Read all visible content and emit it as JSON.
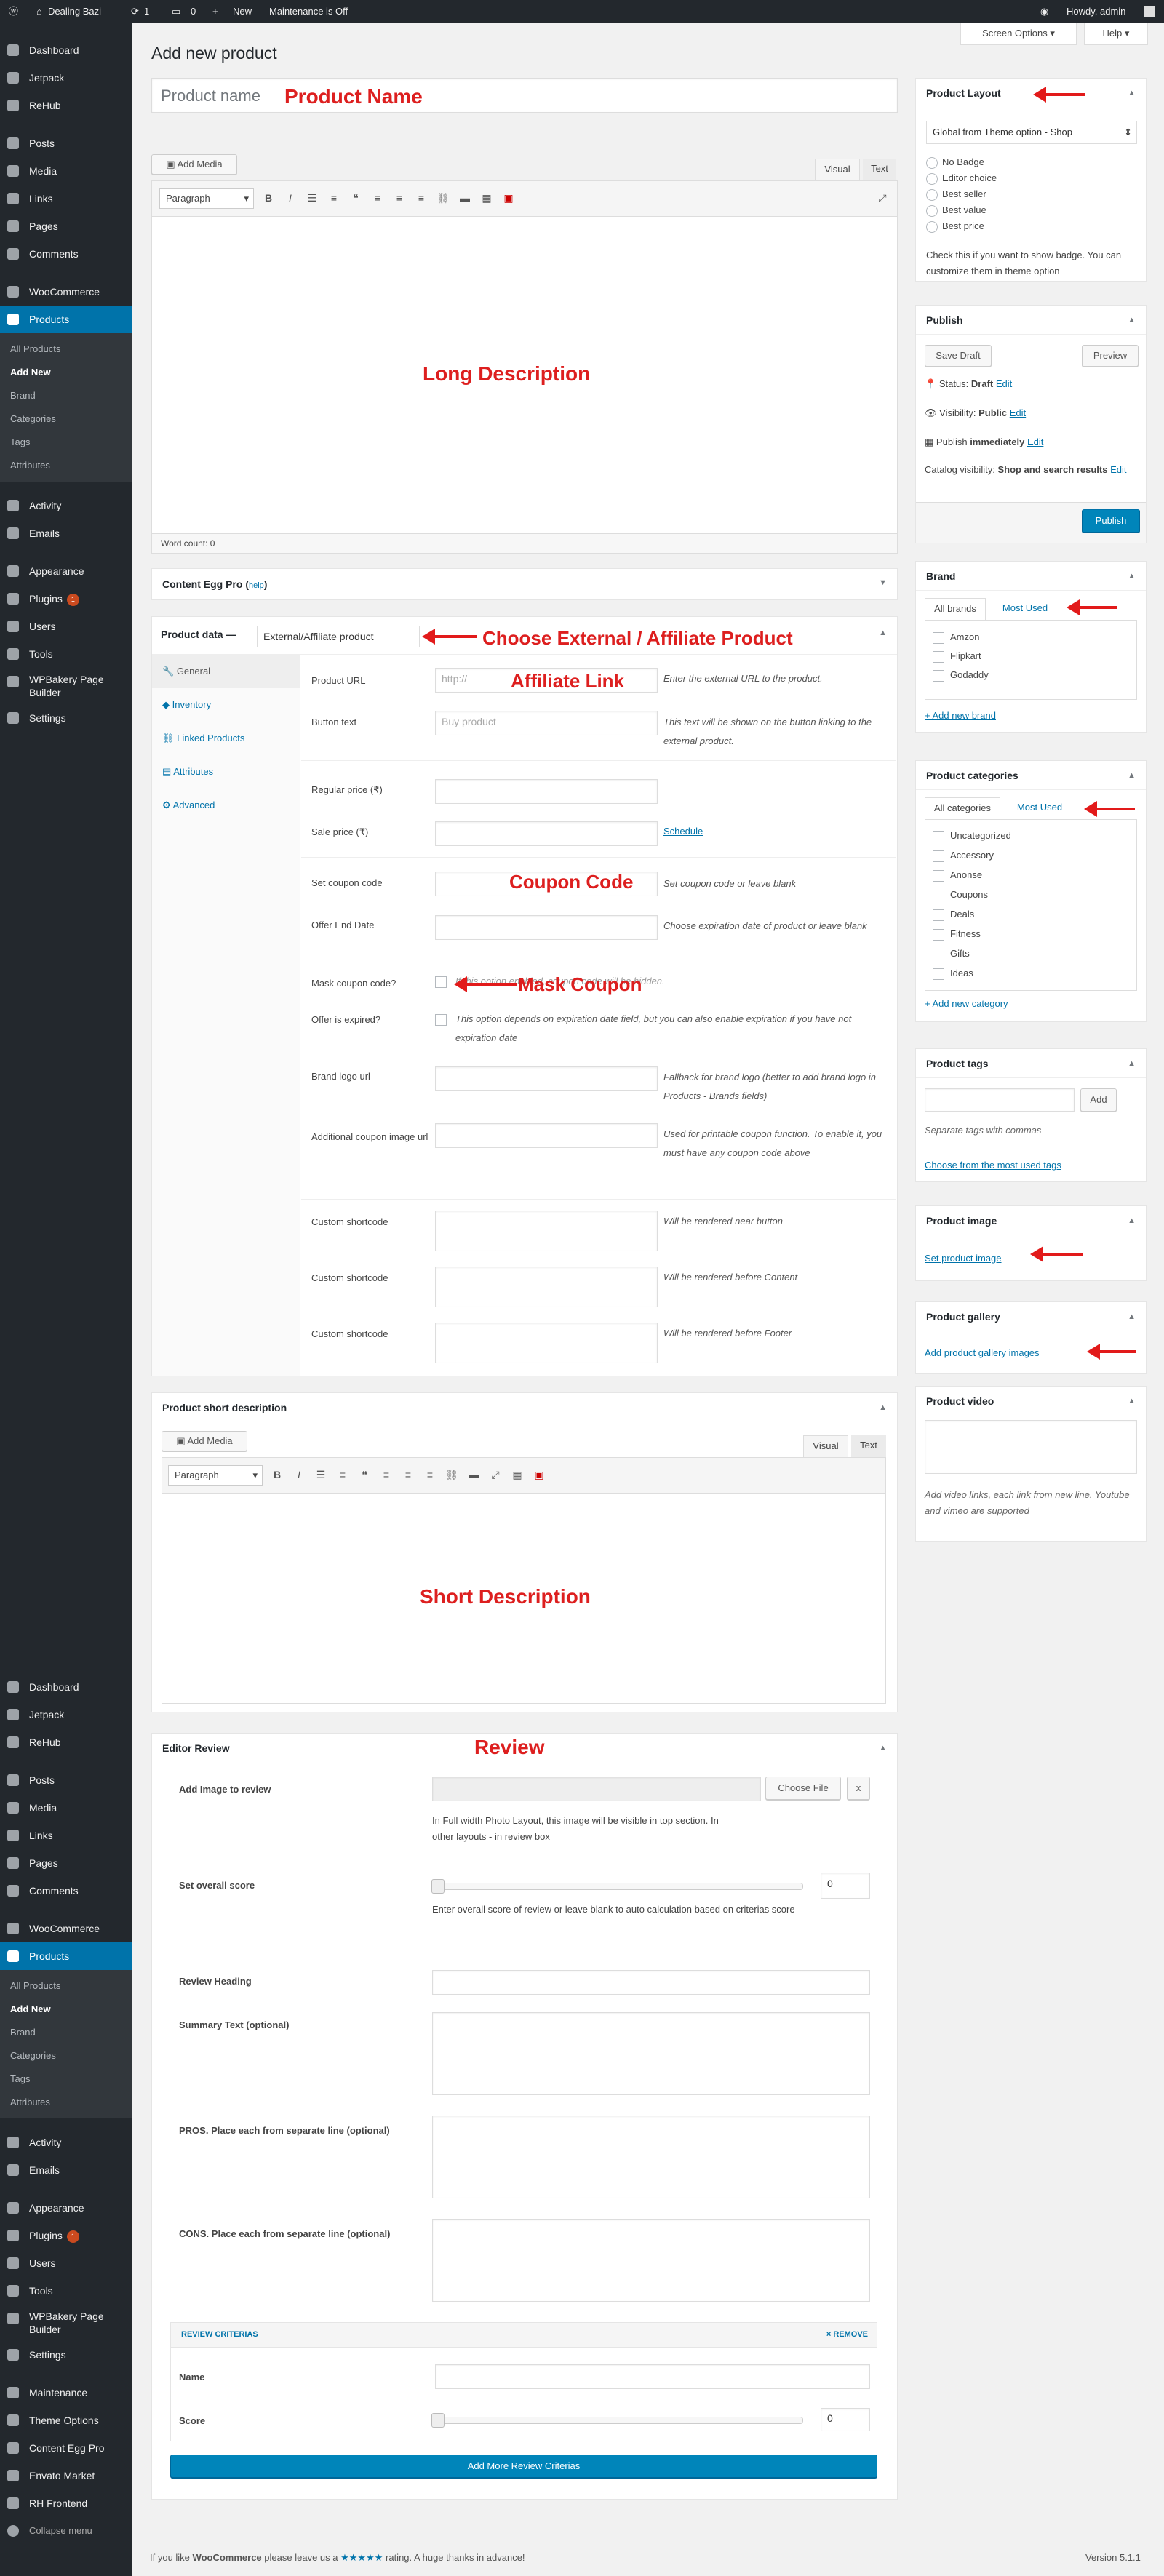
{
  "adminbar": {
    "site": "Dealing Bazi",
    "updates": "1",
    "comments": "0",
    "new": "New",
    "maintenance": "Maintenance is Off",
    "howdy": "Howdy, admin"
  },
  "sidebar": {
    "group1": [
      "Dashboard",
      "Jetpack",
      "ReHub"
    ],
    "group2": [
      "Posts",
      "Media",
      "Links",
      "Pages",
      "Comments"
    ],
    "woocommerce": "WooCommerce",
    "products": "Products",
    "product_sub": [
      "All Products",
      "Add New",
      "Brand",
      "Categories",
      "Tags",
      "Attributes"
    ],
    "group3": [
      "Activity",
      "Emails"
    ],
    "group4": [
      "Appearance",
      "Plugins",
      "Users",
      "Tools",
      "WPBakery Page Builder",
      "Settings"
    ],
    "plugins_badge": "1",
    "group5": [
      "Maintenance",
      "Theme Options",
      "Content Egg Pro",
      "Envato Market",
      "RH Frontend"
    ],
    "collapse": "Collapse menu"
  },
  "header": {
    "title": "Add new product",
    "screen_options": "Screen Options",
    "help": "Help"
  },
  "title_field": {
    "placeholder": "Product name",
    "annotation": "Product Name"
  },
  "editor": {
    "add_media": "Add Media",
    "visual": "Visual",
    "text": "Text",
    "paragraph": "Paragraph",
    "annotation": "Long Description",
    "word_count": "Word count: 0"
  },
  "content_egg": {
    "label": "Content Egg Pro",
    "help": "help"
  },
  "product_data": {
    "label": "Product data —",
    "type": "External/Affiliate product",
    "annotation": "Choose External / Affiliate Product",
    "tabs": [
      "General",
      "Inventory",
      "Linked Products",
      "Attributes",
      "Advanced"
    ],
    "product_url": {
      "label": "Product URL",
      "placeholder": "http://",
      "annotation": "Affiliate Link",
      "desc": "Enter the external URL to the product."
    },
    "button_text": {
      "label": "Button text",
      "placeholder": "Buy product",
      "desc": "This text will be shown on the button linking to the external product."
    },
    "regular_price": "Regular price (₹)",
    "sale_price": "Sale price (₹)",
    "schedule": "Schedule",
    "coupon_code": {
      "label": "Set coupon code",
      "annotation": "Coupon Code",
      "desc": "Set coupon code or leave blank"
    },
    "offer_end": {
      "label": "Offer End Date",
      "desc": "Choose expiration date of product or leave blank"
    },
    "mask_coupon": {
      "label": "Mask coupon code?",
      "desc": "If this option enabled, coupon code will be hidden.",
      "annotation": "Mask Coupon"
    },
    "expired": {
      "label": "Offer is expired?",
      "desc": "This option depends on expiration date field, but you can also enable expiration if you have not expiration date"
    },
    "brand_logo": {
      "label": "Brand logo url",
      "desc": "Fallback for brand logo (better to add brand logo in Products - Brands fields)"
    },
    "coupon_image": {
      "label": "Additional coupon image url",
      "desc": "Used for printable coupon function. To enable it, you must have any coupon code above"
    },
    "shortcodes": [
      {
        "label": "Custom shortcode",
        "desc": "Will be rendered near button"
      },
      {
        "label": "Custom shortcode",
        "desc": "Will be rendered before Content"
      },
      {
        "label": "Custom shortcode",
        "desc": "Will be rendered before Footer"
      }
    ]
  },
  "short_desc": {
    "title": "Product short description",
    "add_media": "Add Media",
    "visual": "Visual",
    "text": "Text",
    "paragraph": "Paragraph",
    "annotation": "Short Description"
  },
  "review": {
    "title": "Editor Review",
    "annotation": "Review",
    "add_image": "Add Image to review",
    "choose_file": "Choose File",
    "x": "x",
    "image_desc": "In Full width Photo Layout, this image will be visible in top section. In other layouts - in review box",
    "overall": "Set overall score",
    "overall_value": "0",
    "overall_desc": "Enter overall score of review or leave blank to auto calculation based on criterias score",
    "heading": "Review Heading",
    "summary": "Summary Text (optional)",
    "pros": "PROS. Place each from separate line (optional)",
    "cons": "CONS. Place each from separate line (optional)",
    "criterias": "REVIEW CRITERIAS",
    "remove": "× REMOVE",
    "name": "Name",
    "score": "Score",
    "score_value": "0",
    "add_more": "Add More Review Criterias"
  },
  "layout_box": {
    "title": "Product Layout",
    "select": "Global from Theme option - Shop",
    "options": [
      "No Badge",
      "Editor choice",
      "Best seller",
      "Best value",
      "Best price"
    ],
    "help": "Check this if you want to show badge. You can customize them in theme option"
  },
  "publish": {
    "title": "Publish",
    "save_draft": "Save Draft",
    "preview": "Preview",
    "status": "Status:",
    "status_value": "Draft",
    "visibility": "Visibility:",
    "visibility_value": "Public",
    "publish_label": "Publish",
    "publish_value": "immediately",
    "edit": "Edit",
    "catalog": "Catalog visibility:",
    "catalog_value": "Shop and search results",
    "button": "Publish"
  },
  "brand": {
    "title": "Brand",
    "tab_all": "All brands",
    "tab_used": "Most Used",
    "items": [
      "Amzon",
      "Flipkart",
      "Godaddy"
    ],
    "add": "+ Add new brand"
  },
  "categories": {
    "title": "Product categories",
    "tab_all": "All categories",
    "tab_used": "Most Used",
    "items": [
      "Uncategorized",
      "Accessory",
      "Anonse",
      "Coupons",
      "Deals",
      "Fitness",
      "Gifts",
      "Ideas"
    ],
    "add": "+ Add new category"
  },
  "tags": {
    "title": "Product tags",
    "add": "Add",
    "help": "Separate tags with commas",
    "choose": "Choose from the most used tags"
  },
  "image": {
    "title": "Product image",
    "link": "Set product image"
  },
  "gallery": {
    "title": "Product gallery",
    "link": "Add product gallery images"
  },
  "video": {
    "title": "Product video",
    "help": "Add video links, each link from new line. Youtube and vimeo are supported"
  },
  "footer": {
    "pre": "If you like",
    "woo": "WooCommerce",
    "mid": "please leave us a",
    "stars": "★★★★★",
    "post": "rating. A huge thanks in advance!",
    "version": "Version 5.1.1"
  }
}
